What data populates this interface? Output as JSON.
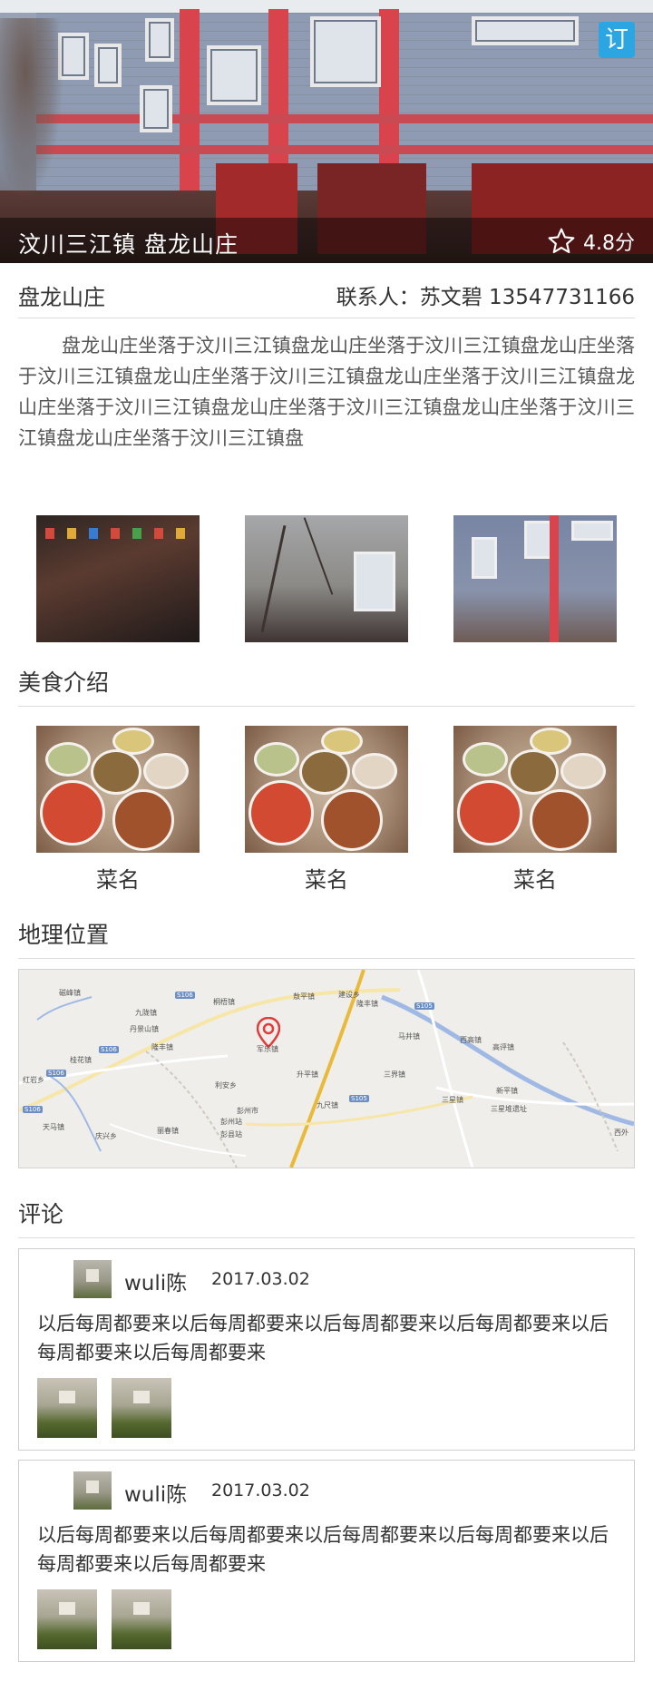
{
  "hero": {
    "title": "汶川三江镇 盘龙山庄",
    "rating": "4.8分",
    "book_button": "订"
  },
  "info": {
    "name": "盘龙山庄",
    "contact": "联系人：苏文碧  13547731166"
  },
  "description": "盘龙山庄坐落于汶川三江镇盘龙山庄坐落于汶川三江镇盘龙山庄坐落于汶川三江镇盘龙山庄坐落于汶川三江镇盘龙山庄坐落于汶川三江镇盘龙山庄坐落于汶川三江镇盘龙山庄坐落于汶川三江镇盘龙山庄坐落于汶川三江镇盘龙山庄坐落于汶川三江镇盘",
  "sections": {
    "food": "美食介绍",
    "location": "地理位置",
    "comments": "评论"
  },
  "dishes": [
    {
      "label": "菜名"
    },
    {
      "label": "菜名"
    },
    {
      "label": "菜名"
    }
  ],
  "map": {
    "labels": [
      "磁峰镇",
      "九陇镇",
      "桐梧镇",
      "敖平镇",
      "建设乡",
      "隆丰镇",
      "丹景山镇",
      "隆丰镇",
      "军乐镇",
      "马井镇",
      "西高镇",
      "高评镇",
      "桂花镇",
      "升平镇",
      "三界镇",
      "新平镇",
      "利安乡",
      "九尺镇",
      "三星镇",
      "三星堆遗址",
      "彭州市",
      "彭州站",
      "彭县站",
      "天马镇",
      "庆兴乡",
      "丽春镇",
      "西外",
      "红岩乡"
    ],
    "road_tags": [
      "S106",
      "S106",
      "S106",
      "S105",
      "S105",
      "S106"
    ]
  },
  "comments": [
    {
      "user": "wuli陈",
      "date": "2017.03.02",
      "text": "以后每周都要来以后每周都要来以后每周都要来以后每周都要来以后每周都要来以后每周都要来"
    },
    {
      "user": "wuli陈",
      "date": "2017.03.02",
      "text": "以后每周都要来以后每周都要来以后每周都要来以后每周都要来以后每周都要来以后每周都要来"
    }
  ],
  "colors": {
    "accent_blue": "#2ba6e3",
    "map_pin": "#e03c3c",
    "divider": "#dcdcdc"
  },
  "icons": {
    "rating": "star-outline-icon",
    "map_marker": "map-pin-icon"
  }
}
